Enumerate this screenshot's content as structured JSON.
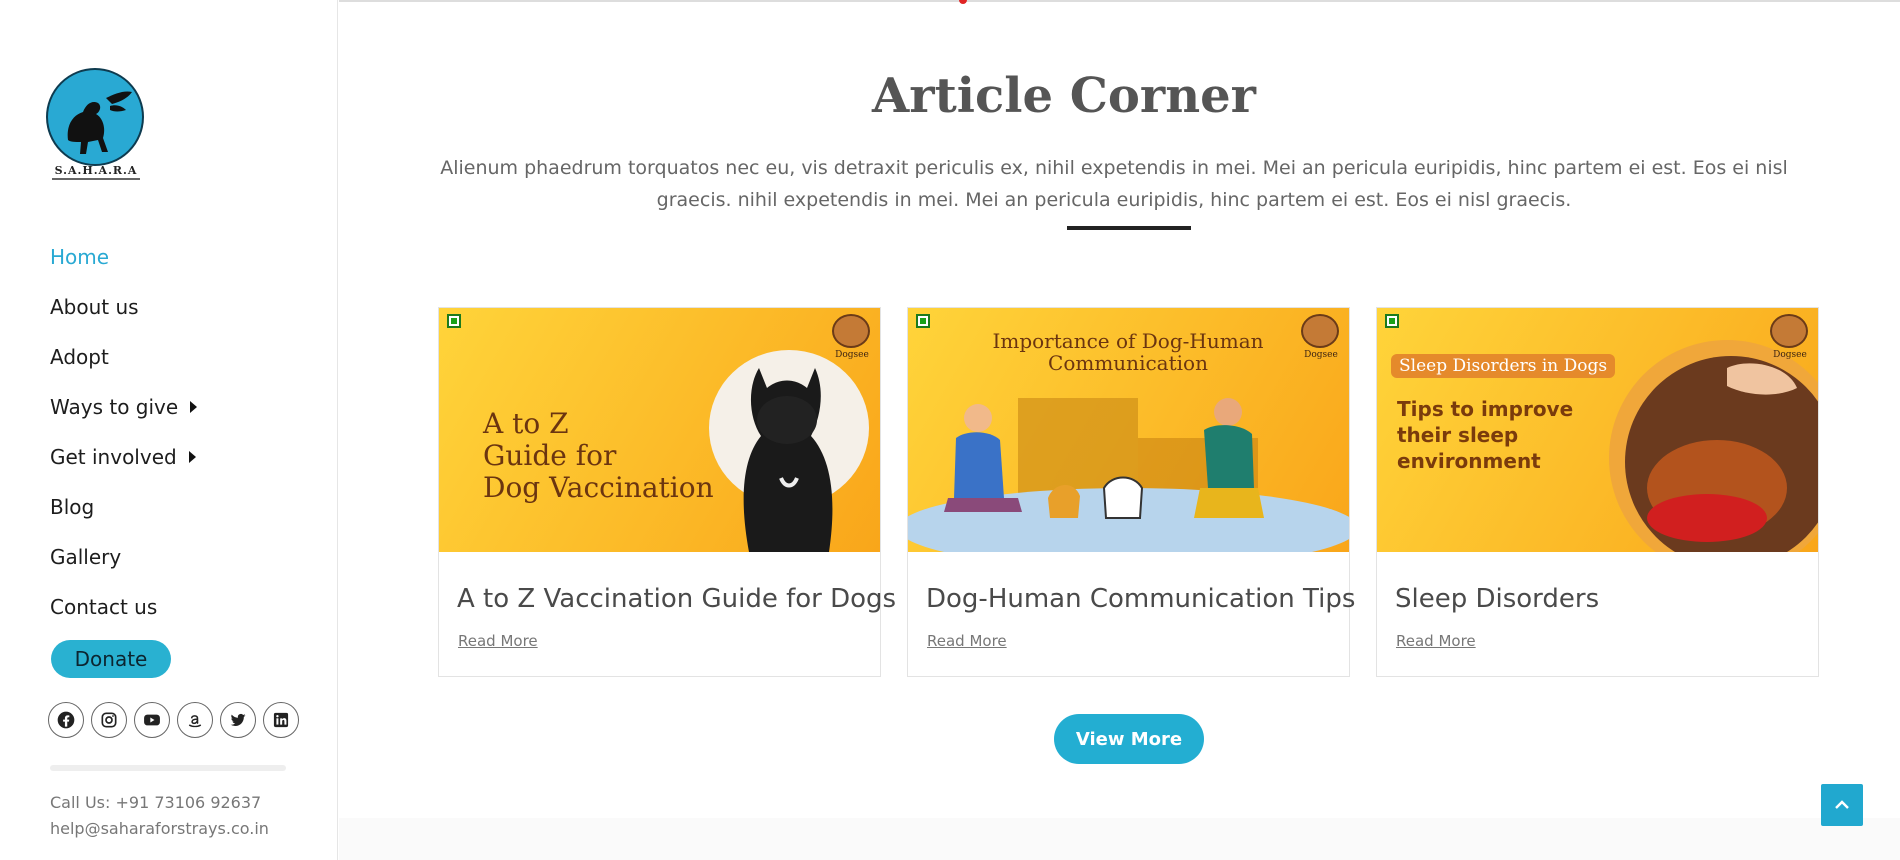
{
  "sidebar": {
    "logo": {
      "text": "S.A.H.A.R.A"
    },
    "nav": [
      {
        "label": "Home",
        "active": true
      },
      {
        "label": "About us"
      },
      {
        "label": "Adopt"
      },
      {
        "label": "Ways to give",
        "has_submenu": true
      },
      {
        "label": "Get involved",
        "has_submenu": true
      },
      {
        "label": "Blog"
      },
      {
        "label": "Gallery"
      },
      {
        "label": "Contact us"
      }
    ],
    "donate_label": "Donate",
    "socials": [
      "facebook-icon",
      "instagram-icon",
      "youtube-icon",
      "amazon-icon",
      "twitter-icon",
      "linkedin-icon"
    ],
    "contact": {
      "phone": "Call Us: +91 73106 92637",
      "email": "help@saharaforstrays.co.in"
    }
  },
  "main": {
    "title": "Article Corner",
    "description": "Alienum phaedrum torquatos nec eu, vis detraxit periculis ex, nihil expetendis in mei. Mei an pericula euripidis, hinc partem ei est. Eos ei nisl graecis. nihil expetendis in mei. Mei an pericula euripidis, hinc partem ei est. Eos ei nisl graecis.",
    "articles": [
      {
        "title": "A to Z Vaccination Guide for Dogs",
        "read_more": "Read More",
        "image_text": [
          "A to Z",
          "Guide for",
          "Dog Vaccination"
        ],
        "brand": "Dogsee"
      },
      {
        "title": "Dog-Human Communication Tips",
        "read_more": "Read More",
        "image_text": [
          "Importance of Dog-Human",
          "Communication"
        ],
        "brand": "Dogsee"
      },
      {
        "title": "Sleep Disorders",
        "read_more": "Read More",
        "image_text": [
          "Sleep Disorders in Dogs",
          "Tips to improve",
          "their sleep",
          "environment"
        ],
        "brand": "Dogsee"
      }
    ],
    "view_more_label": "View More"
  },
  "colors": {
    "accent": "#29a9d3",
    "button": "#23aed2",
    "title": "#555555"
  }
}
